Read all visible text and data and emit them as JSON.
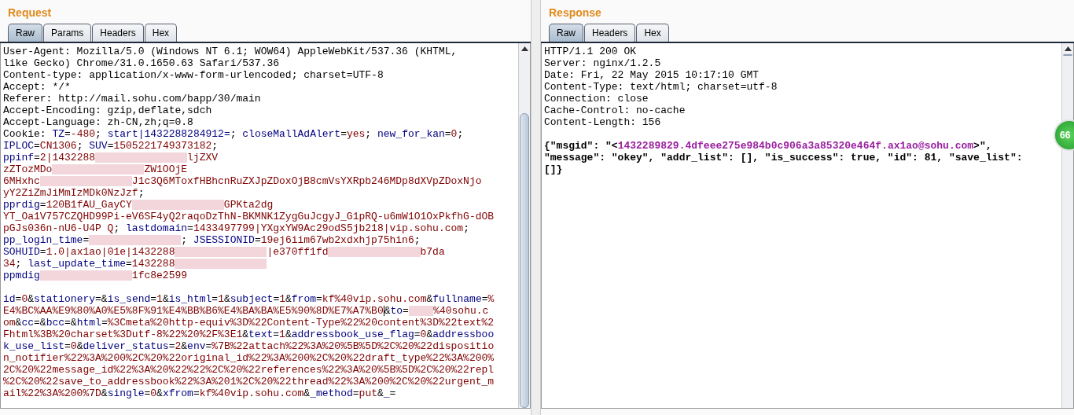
{
  "request": {
    "title": "Request",
    "tabs": [
      {
        "label": "Raw",
        "selected": true
      },
      {
        "label": "Params",
        "selected": false
      },
      {
        "label": "Headers",
        "selected": false
      },
      {
        "label": "Hex",
        "selected": false
      }
    ],
    "lines": [
      [
        {
          "kind": "plain",
          "text": "User-Agent: Mozilla/5.0 (Windows NT 6.1; WOW64) AppleWebKit/537.36 (KHTML,"
        }
      ],
      [
        {
          "kind": "plain",
          "text": "like Gecko) Chrome/31.0.1650.63 Safari/537.36"
        }
      ],
      [
        {
          "kind": "plain",
          "text": "Content-type: application/x-www-form-urlencoded; charset=UTF-8"
        }
      ],
      [
        {
          "kind": "plain",
          "text": "Accept: */*"
        }
      ],
      [
        {
          "kind": "plain",
          "text": "Referer: http://mail.sohu.com/bapp/30/main"
        }
      ],
      [
        {
          "kind": "plain",
          "text": "Accept-Encoding: gzip,deflate,sdch"
        }
      ],
      [
        {
          "kind": "plain",
          "text": "Accept-Language: zh-CN,zh;q=0.8"
        }
      ],
      [
        {
          "kind": "plain",
          "text": "Cookie: "
        },
        {
          "kind": "name",
          "text": "TZ"
        },
        {
          "kind": "plain",
          "text": "="
        },
        {
          "kind": "value",
          "text": "-480"
        },
        {
          "kind": "plain",
          "text": "; "
        },
        {
          "kind": "name",
          "text": "start|1432288284912="
        },
        {
          "kind": "plain",
          "text": "; "
        },
        {
          "kind": "name",
          "text": "closeMallAdAlert"
        },
        {
          "kind": "plain",
          "text": "="
        },
        {
          "kind": "value",
          "text": "yes"
        },
        {
          "kind": "plain",
          "text": "; "
        },
        {
          "kind": "name",
          "text": "new_for_kan"
        },
        {
          "kind": "plain",
          "text": "="
        },
        {
          "kind": "value",
          "text": "0"
        },
        {
          "kind": "plain",
          "text": ";"
        }
      ],
      [
        {
          "kind": "name",
          "text": "IPLOC"
        },
        {
          "kind": "plain",
          "text": "="
        },
        {
          "kind": "value",
          "text": "CN1306"
        },
        {
          "kind": "plain",
          "text": "; "
        },
        {
          "kind": "name",
          "text": "SUV"
        },
        {
          "kind": "plain",
          "text": "="
        },
        {
          "kind": "value",
          "text": "1505221749373182"
        },
        {
          "kind": "plain",
          "text": ";"
        }
      ],
      [
        {
          "kind": "name",
          "text": "ppinf"
        },
        {
          "kind": "plain",
          "text": "="
        },
        {
          "kind": "value",
          "text": "2|1432288"
        },
        {
          "kind": "redacted"
        },
        {
          "kind": "value",
          "text": "ljZXV"
        }
      ],
      [
        {
          "kind": "value",
          "text": "zZTozMDo"
        },
        {
          "kind": "redacted"
        },
        {
          "kind": "value",
          "text": "ZW1OOjE"
        }
      ],
      [
        {
          "kind": "value",
          "text": "6MHxhc"
        },
        {
          "kind": "redacted"
        },
        {
          "kind": "value",
          "text": "J1c3Q6MToxfHBhcnRuZXJpZDoxOjB8cmVsYXRpb246MDp8dXVpZDoxNjo"
        }
      ],
      [
        {
          "kind": "value",
          "text": "yY2ZiZmJiMmIzMDk0NzJzf"
        },
        {
          "kind": "plain",
          "text": ";"
        }
      ],
      [
        {
          "kind": "name",
          "text": "pprdig"
        },
        {
          "kind": "plain",
          "text": "="
        },
        {
          "kind": "value",
          "text": "120B1fAU_GayCY"
        },
        {
          "kind": "redacted"
        },
        {
          "kind": "value",
          "text": "GPKta2dg"
        }
      ],
      [
        {
          "kind": "value",
          "text": "YT_Oa1V757CZQHD99Pi-eV6SF4yQ2raqoDzThN-BKMNK1ZygGuJcgyJ_G1pRQ-u6mW1O1OxPkfhG-dOB"
        }
      ],
      [
        {
          "kind": "value",
          "text": "pGJs036n-nU6-U4P Q"
        },
        {
          "kind": "plain",
          "text": "; "
        },
        {
          "kind": "name",
          "text": "lastdomain"
        },
        {
          "kind": "plain",
          "text": "="
        },
        {
          "kind": "value",
          "text": "1433497799|YXgxYW9Ac29odS5jb218|vip.sohu.com"
        },
        {
          "kind": "plain",
          "text": ";"
        }
      ],
      [
        {
          "kind": "name",
          "text": "pp_login_time"
        },
        {
          "kind": "plain",
          "text": "="
        },
        {
          "kind": "redacted"
        },
        {
          "kind": "plain",
          "text": "; "
        },
        {
          "kind": "name",
          "text": "JSESSIONID"
        },
        {
          "kind": "plain",
          "text": "="
        },
        {
          "kind": "value",
          "text": "19ej6iim67wb2xdxhjp75hin6"
        },
        {
          "kind": "plain",
          "text": ";"
        }
      ],
      [
        {
          "kind": "name",
          "text": "SOHUID"
        },
        {
          "kind": "plain",
          "text": "="
        },
        {
          "kind": "value",
          "text": "1.0|ax1ao|01e|1432288"
        },
        {
          "kind": "redacted"
        },
        {
          "kind": "value",
          "text": "|e370ff1fd"
        },
        {
          "kind": "redacted"
        },
        {
          "kind": "value",
          "text": "b7da"
        }
      ],
      [
        {
          "kind": "value",
          "text": "34"
        },
        {
          "kind": "plain",
          "text": "; "
        },
        {
          "kind": "name",
          "text": "last_update_time"
        },
        {
          "kind": "plain",
          "text": "="
        },
        {
          "kind": "value",
          "text": "1432288"
        },
        {
          "kind": "redacted"
        }
      ],
      [
        {
          "kind": "name",
          "text": "ppmdig"
        },
        {
          "kind": "redacted"
        },
        {
          "kind": "value",
          "text": "1fc8e2599"
        }
      ],
      [
        {
          "kind": "blank"
        }
      ],
      [
        {
          "kind": "name",
          "text": "id"
        },
        {
          "kind": "plain",
          "text": "="
        },
        {
          "kind": "value",
          "text": "0"
        },
        {
          "kind": "plain",
          "text": "&"
        },
        {
          "kind": "name",
          "text": "stationery"
        },
        {
          "kind": "plain",
          "text": "=&"
        },
        {
          "kind": "name",
          "text": "is_send"
        },
        {
          "kind": "plain",
          "text": "="
        },
        {
          "kind": "value",
          "text": "1"
        },
        {
          "kind": "plain",
          "text": "&"
        },
        {
          "kind": "name",
          "text": "is_html"
        },
        {
          "kind": "plain",
          "text": "="
        },
        {
          "kind": "value",
          "text": "1"
        },
        {
          "kind": "plain",
          "text": "&"
        },
        {
          "kind": "name",
          "text": "subject"
        },
        {
          "kind": "plain",
          "text": "="
        },
        {
          "kind": "value",
          "text": "1"
        },
        {
          "kind": "plain",
          "text": "&"
        },
        {
          "kind": "name",
          "text": "from"
        },
        {
          "kind": "plain",
          "text": "="
        },
        {
          "kind": "value",
          "text": "kf%40vip.sohu.com"
        },
        {
          "kind": "plain",
          "text": "&"
        },
        {
          "kind": "name",
          "text": "fullname"
        },
        {
          "kind": "plain",
          "text": "="
        },
        {
          "kind": "value",
          "text": "%"
        }
      ],
      [
        {
          "kind": "value",
          "text": "E4%BC%AA%E9%80%A0%E5%8F%91%E4%BB%B6%E4%BA%BA%E5%90%8D%E7%A7%B0"
        },
        {
          "kind": "caret"
        },
        {
          "kind": "plain",
          "text": "&"
        },
        {
          "kind": "name",
          "text": "to"
        },
        {
          "kind": "plain",
          "text": "="
        },
        {
          "kind": "redacted_small"
        },
        {
          "kind": "value",
          "text": "%40sohu.c"
        }
      ],
      [
        {
          "kind": "value",
          "text": "om"
        },
        {
          "kind": "plain",
          "text": "&"
        },
        {
          "kind": "name",
          "text": "cc"
        },
        {
          "kind": "plain",
          "text": "=&"
        },
        {
          "kind": "name",
          "text": "bcc"
        },
        {
          "kind": "plain",
          "text": "=&"
        },
        {
          "kind": "name",
          "text": "html"
        },
        {
          "kind": "plain",
          "text": "="
        },
        {
          "kind": "value",
          "text": "%3Cmeta%20http-equiv%3D%22Content-Type%22%20content%3D%22text%2"
        }
      ],
      [
        {
          "kind": "value",
          "text": "Fhtml%3B%20charset%3Dutf-8%22%20%2F%3E1"
        },
        {
          "kind": "plain",
          "text": "&"
        },
        {
          "kind": "name",
          "text": "text"
        },
        {
          "kind": "plain",
          "text": "="
        },
        {
          "kind": "value",
          "text": "1"
        },
        {
          "kind": "plain",
          "text": "&"
        },
        {
          "kind": "name",
          "text": "addressbook_use_flag"
        },
        {
          "kind": "plain",
          "text": "="
        },
        {
          "kind": "value",
          "text": "0"
        },
        {
          "kind": "plain",
          "text": "&"
        },
        {
          "kind": "name",
          "text": "addressboo"
        }
      ],
      [
        {
          "kind": "name",
          "text": "k_use_list"
        },
        {
          "kind": "plain",
          "text": "="
        },
        {
          "kind": "value",
          "text": "0"
        },
        {
          "kind": "plain",
          "text": "&"
        },
        {
          "kind": "name",
          "text": "deliver_status"
        },
        {
          "kind": "plain",
          "text": "="
        },
        {
          "kind": "value",
          "text": "2"
        },
        {
          "kind": "plain",
          "text": "&"
        },
        {
          "kind": "name",
          "text": "env"
        },
        {
          "kind": "plain",
          "text": "="
        },
        {
          "kind": "value",
          "text": "%7B%22attach%22%3A%20%5B%5D%2C%20%22dispositio"
        }
      ],
      [
        {
          "kind": "value",
          "text": "n_notifier%22%3A%200%2C%20%22original_id%22%3A%200%2C%20%22draft_type%22%3A%200%"
        }
      ],
      [
        {
          "kind": "value",
          "text": "2C%20%22message_id%22%3A%20%22%22%2C%20%22references%22%3A%20%5B%5D%2C%20%22repl"
        }
      ],
      [
        {
          "kind": "value",
          "text": "%2C%20%22save_to_addressbook%22%3A%201%2C%20%22thread%22%3A%200%2C%20%22urgent_m"
        }
      ],
      [
        {
          "kind": "value",
          "text": "ail%22%3A%200%7D"
        },
        {
          "kind": "plain",
          "text": "&"
        },
        {
          "kind": "name",
          "text": "single"
        },
        {
          "kind": "plain",
          "text": "="
        },
        {
          "kind": "value",
          "text": "0"
        },
        {
          "kind": "plain",
          "text": "&"
        },
        {
          "kind": "name",
          "text": "xfrom"
        },
        {
          "kind": "plain",
          "text": "="
        },
        {
          "kind": "value",
          "text": "kf%40vip.sohu.com"
        },
        {
          "kind": "plain",
          "text": "&"
        },
        {
          "kind": "name",
          "text": "_method"
        },
        {
          "kind": "plain",
          "text": "="
        },
        {
          "kind": "value",
          "text": "put"
        },
        {
          "kind": "plain",
          "text": "&"
        },
        {
          "kind": "name",
          "text": "_"
        },
        {
          "kind": "plain",
          "text": "="
        }
      ]
    ]
  },
  "response": {
    "title": "Response",
    "tabs": [
      {
        "label": "Raw",
        "selected": true
      },
      {
        "label": "Headers",
        "selected": false
      },
      {
        "label": "Hex",
        "selected": false
      }
    ],
    "lines": [
      [
        {
          "kind": "plain",
          "text": "HTTP/1.1 200 OK"
        }
      ],
      [
        {
          "kind": "plain",
          "text": "Server: nginx/1.2.5"
        }
      ],
      [
        {
          "kind": "plain",
          "text": "Date: Fri, 22 May 2015 10:17:10 GMT"
        }
      ],
      [
        {
          "kind": "plain",
          "text": "Content-Type: text/html; charset=utf-8"
        }
      ],
      [
        {
          "kind": "plain",
          "text": "Connection: close"
        }
      ],
      [
        {
          "kind": "plain",
          "text": "Cache-Control: no-cache"
        }
      ],
      [
        {
          "kind": "plain",
          "text": "Content-Length: 156"
        }
      ],
      [
        {
          "kind": "blank"
        }
      ],
      [
        {
          "kind": "bold",
          "text": "{\"msgid\": \"<"
        },
        {
          "kind": "string",
          "text": "1432289829.4dfeee275e984b0c906a3a85320e464f.ax1ao@sohu.com"
        },
        {
          "kind": "bold",
          "text": ">\","
        }
      ],
      [
        {
          "kind": "bold",
          "text": "\"message\": \"okey\", \"addr_list\": [], \"is_success\": true, \"id\": 81, \"save_list\":"
        }
      ],
      [
        {
          "kind": "bold",
          "text": "[]}"
        }
      ]
    ]
  },
  "floating_badge": "66"
}
